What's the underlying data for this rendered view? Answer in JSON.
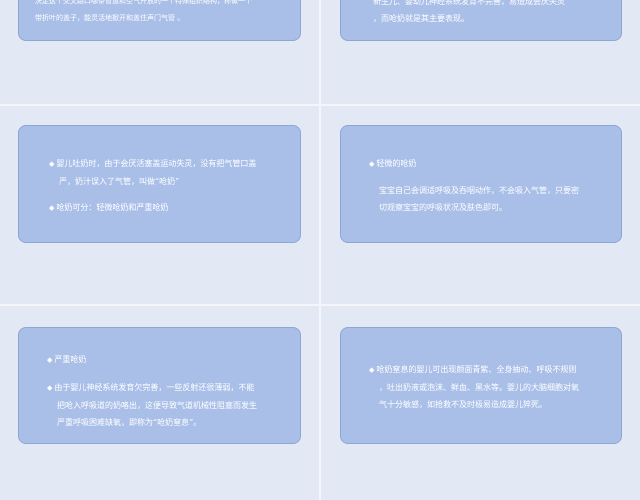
{
  "slide_top": {
    "left": [
      "决定这个交叉路口哪条管道和空气开放的一个特殊组织结构，称做一个",
      "带折叶的盖子，能灵活地掀开和盖住声门气管 。"
    ],
    "right": [
      "新生儿、婴幼儿神经系统发育不完善，易造成会厌失灵",
      "，而呛奶就是其主要表现。"
    ]
  },
  "slide_middle": {
    "left_para1_line1": "婴儿吐奶时，由于会厌活塞盖运动失灵，没有把气管口盖",
    "left_para1_line2": "严，奶汁误入了气管，叫做“呛奶”",
    "left_para2": "呛奶可分：轻微呛奶和严重呛奶",
    "right_heading": "轻微的呛奶",
    "right_para_line1": "宝宝自己会调适呼吸及吞咽动作，不会吸入气管，只要密",
    "right_para_line2": "切观察宝宝的呼吸状况及肤色即可。"
  },
  "slide_bottom": {
    "left_heading": "严重呛奶",
    "left_para_line1": "由于婴儿神经系统发育欠完善，一些反射还很薄弱，不能",
    "left_para_line2": "把呛入呼吸道的奶咯出，这便导致气道机械性阻塞而发生",
    "left_para_line3": "严重呼吸困难缺氧，即称为“呛奶窒息”。",
    "right_para_line1": "呛奶窒息的婴儿可出现颜面青紫、全身抽动、呼吸不规则",
    "right_para_line2": "，吐出奶液或泡沫、鲜血、黑水等。婴儿的大脑细胞对氧",
    "right_para_line3": "气十分敏感，如抢救不及时极易造成婴儿猝死。"
  },
  "bullet_char": "◆",
  "colors": {
    "background": "#dde4f3",
    "card": "#a9bfe8",
    "card_border": "#8ea6d6",
    "text": "#ffffff"
  }
}
